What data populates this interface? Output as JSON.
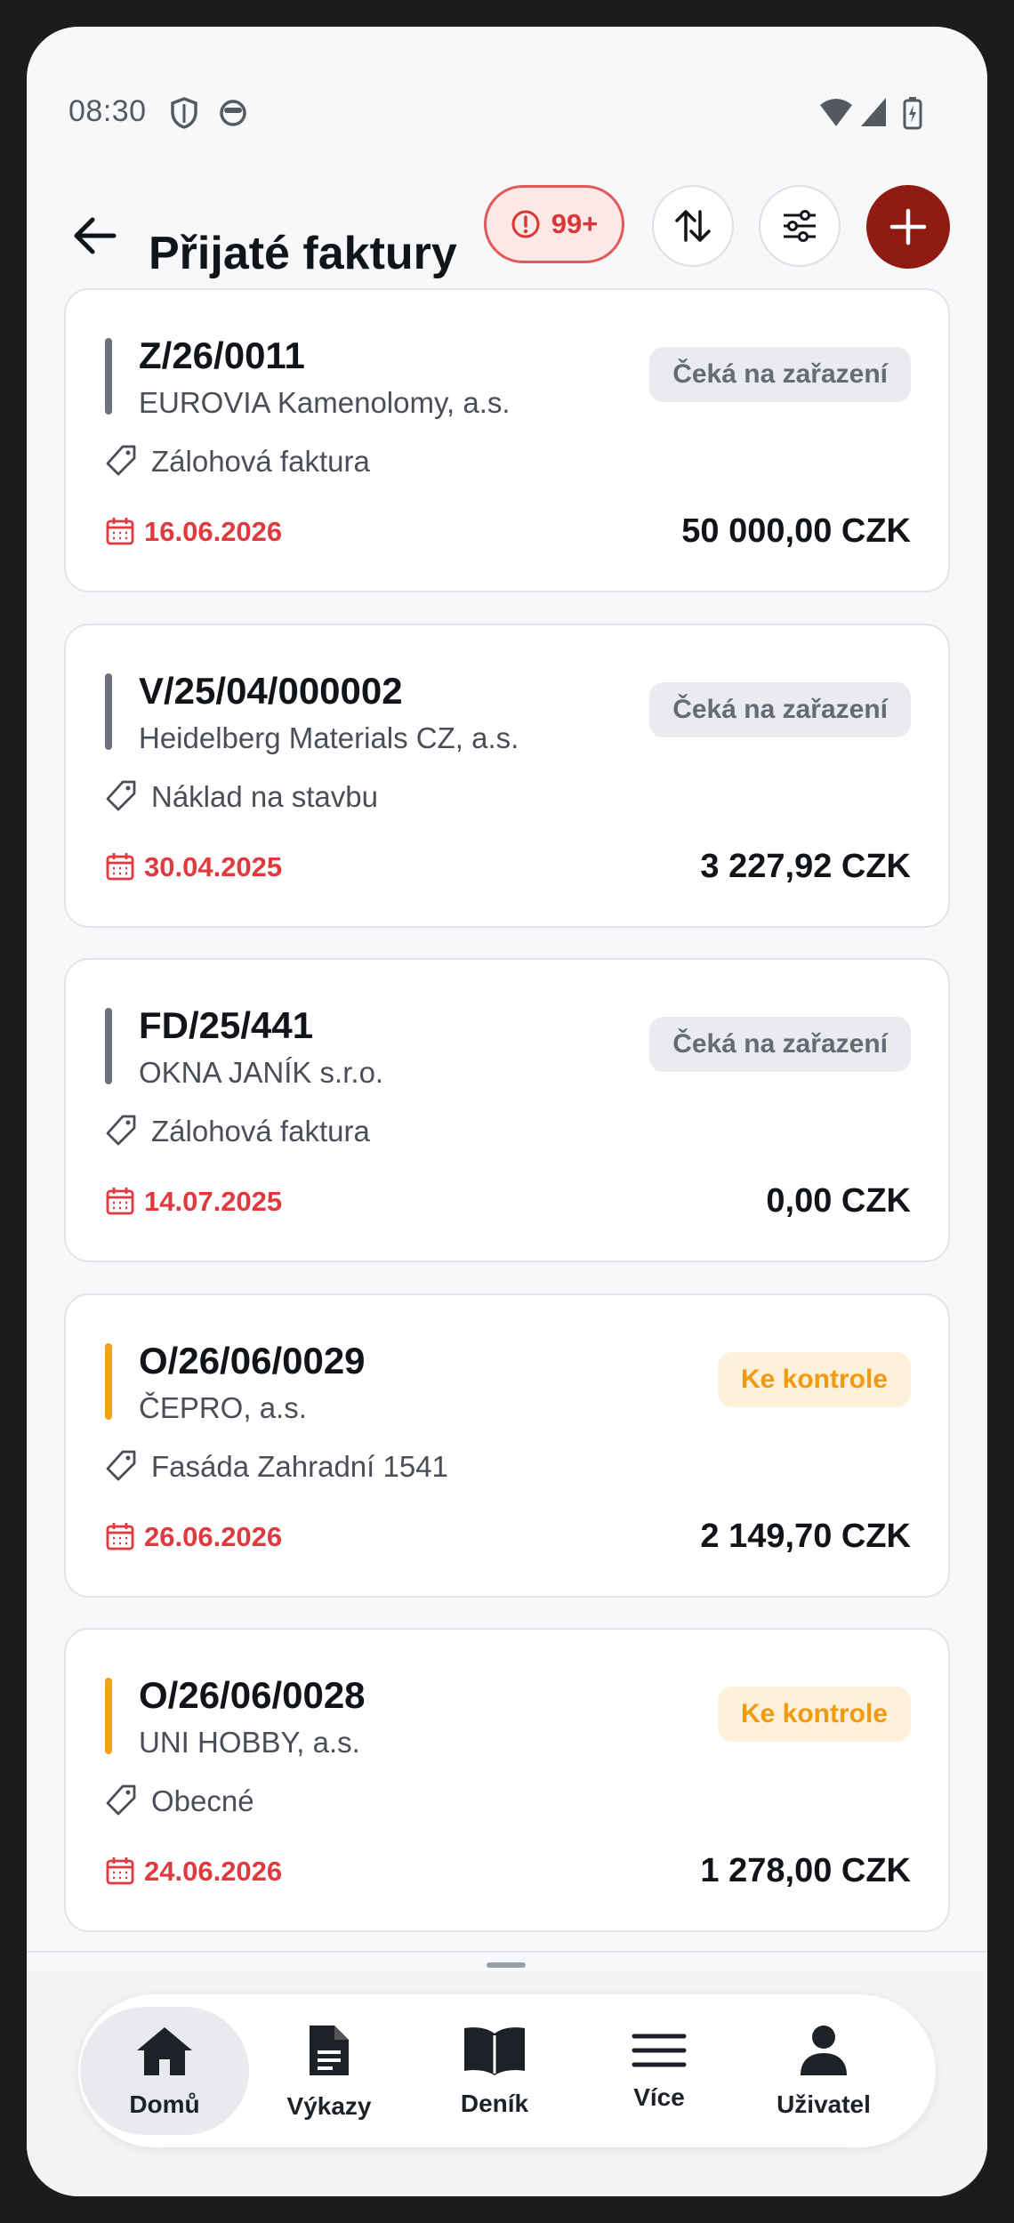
{
  "status_bar": {
    "time": "08:30"
  },
  "header": {
    "title": "Přijaté faktury",
    "alert_count": "99+"
  },
  "invoices": [
    {
      "number": "Z/26/0011",
      "supplier": "EUROVIA Kamenolomy, a.s.",
      "category": "Zálohová faktura",
      "date": "16.06.2026",
      "amount": "50 000,00 CZK",
      "status": "Čeká na zařazení",
      "status_type": "grey",
      "bar_color": "#6c727b"
    },
    {
      "number": "V/25/04/000002",
      "supplier": "Heidelberg Materials CZ, a.s.",
      "category": "Náklad na stavbu",
      "date": "30.04.2025",
      "amount": "3 227,92 CZK",
      "status": "Čeká na zařazení",
      "status_type": "grey",
      "bar_color": "#6c727b"
    },
    {
      "number": "FD/25/441",
      "supplier": "OKNA JANÍK s.r.o.",
      "category": "Zálohová faktura",
      "date": "14.07.2025",
      "amount": "0,00 CZK",
      "status": "Čeká na zařazení",
      "status_type": "grey",
      "bar_color": "#6c727b"
    },
    {
      "number": "O/26/06/0029",
      "supplier": "ČEPRO, a.s.",
      "category": "Fasáda Zahradní 1541",
      "date": "26.06.2026",
      "amount": "2 149,70 CZK",
      "status": "Ke kontrole",
      "status_type": "orange",
      "bar_color": "#f0a21a"
    },
    {
      "number": "O/26/06/0028",
      "supplier": "UNI HOBBY, a.s.",
      "category": "Obecné",
      "date": "24.06.2026",
      "amount": "1 278,00 CZK",
      "status": "Ke kontrole",
      "status_type": "orange",
      "bar_color": "#f0a21a"
    }
  ],
  "nav": [
    {
      "label": "Domů",
      "icon": "home-icon",
      "active": true
    },
    {
      "label": "Výkazy",
      "icon": "document-icon",
      "active": false
    },
    {
      "label": "Deník",
      "icon": "book-icon",
      "active": false
    },
    {
      "label": "Více",
      "icon": "menu-icon",
      "active": false
    },
    {
      "label": "Uživatel",
      "icon": "user-icon",
      "active": false
    }
  ],
  "colors": {
    "accent": "#8f1b12",
    "alert": "#d93636",
    "date": "#e0393e"
  }
}
